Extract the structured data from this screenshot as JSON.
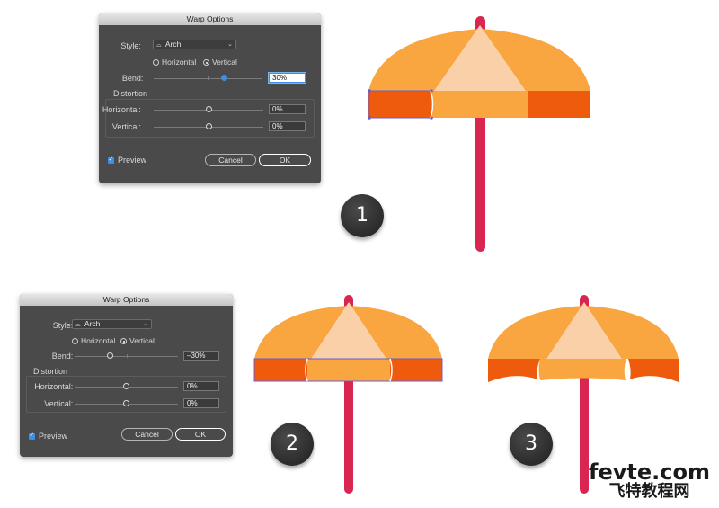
{
  "colors": {
    "canopy_light": "#f9a540",
    "canopy_pale": "#fad0a8",
    "canopy_dark": "#ef5b0c",
    "pole": "#d92651",
    "selection": "#6c5ccf",
    "dialog_bg": "#4a4a4a",
    "accent_blue": "#3d8ee6"
  },
  "dialogs": [
    {
      "title": "Warp Options",
      "style_label": "Style:",
      "style_value": "Arch",
      "orientation_horizontal": "Horizontal",
      "orientation_vertical": "Vertical",
      "orientation_selected": "Vertical",
      "bend_label": "Bend:",
      "bend_value": "30%",
      "bend_level": 0.3,
      "distortion_label": "Distortion",
      "dist_horizontal_label": "Horizontal:",
      "dist_horizontal_value": "0%",
      "dist_vertical_label": "Vertical:",
      "dist_vertical_value": "0%",
      "preview_label": "Preview",
      "preview_checked": true,
      "cancel_label": "Cancel",
      "ok_label": "OK"
    },
    {
      "title": "Warp Options",
      "style_label": "Style:",
      "style_value": "Arch",
      "orientation_horizontal": "Horizontal",
      "orientation_vertical": "Vertical",
      "orientation_selected": "Vertical",
      "bend_label": "Bend:",
      "bend_value": "–30%",
      "bend_level": -0.3,
      "distortion_label": "Distortion",
      "dist_horizontal_label": "Horizontal:",
      "dist_horizontal_value": "0%",
      "dist_vertical_label": "Vertical:",
      "dist_vertical_value": "0%",
      "preview_label": "Preview",
      "preview_checked": true,
      "cancel_label": "Cancel",
      "ok_label": "OK"
    }
  ],
  "steps": [
    "1",
    "2",
    "3"
  ],
  "watermark": {
    "domain": "fevte.com",
    "chinese": "飞特教程网"
  }
}
